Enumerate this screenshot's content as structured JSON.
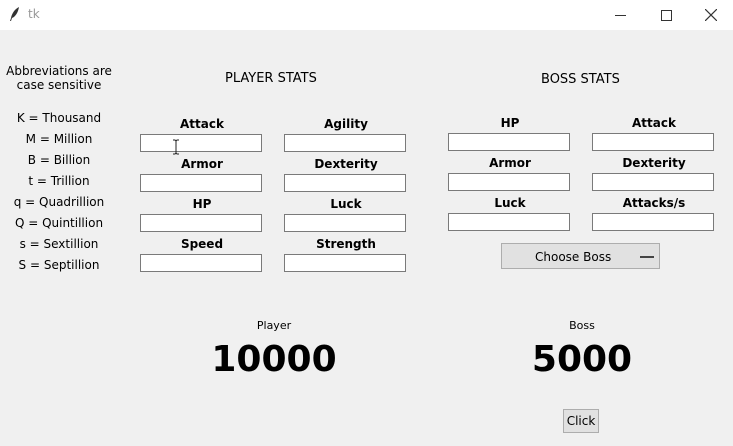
{
  "window": {
    "title": "tk"
  },
  "left_note": {
    "line1": "Abbreviations are",
    "line2": "case sensitive"
  },
  "abbreviations": [
    "K = Thousand",
    "M = Million",
    "B = Billion",
    "t = Trillion",
    "q = Quadrillion",
    "Q = Quintillion",
    "s = Sextillion",
    "S = Septillion"
  ],
  "player": {
    "heading": "PLAYER STATS",
    "fields": {
      "attack": {
        "label": "Attack",
        "value": ""
      },
      "agility": {
        "label": "Agility",
        "value": ""
      },
      "armor": {
        "label": "Armor",
        "value": ""
      },
      "dexterity": {
        "label": "Dexterity",
        "value": ""
      },
      "hp": {
        "label": "HP",
        "value": ""
      },
      "luck": {
        "label": "Luck",
        "value": ""
      },
      "speed": {
        "label": "Speed",
        "value": ""
      },
      "strength": {
        "label": "Strength",
        "value": ""
      }
    },
    "result_label": "Player",
    "result_value": "10000"
  },
  "boss": {
    "heading": "BOSS STATS",
    "fields": {
      "hp": {
        "label": "HP",
        "value": ""
      },
      "attack": {
        "label": "Attack",
        "value": ""
      },
      "armor": {
        "label": "Armor",
        "value": ""
      },
      "dexterity": {
        "label": "Dexterity",
        "value": ""
      },
      "luck": {
        "label": "Luck",
        "value": ""
      },
      "attacks_s": {
        "label": "Attacks/s",
        "value": ""
      }
    },
    "choose_label": "Choose Boss",
    "result_label": "Boss",
    "result_value": "5000"
  },
  "click_label": "Click"
}
